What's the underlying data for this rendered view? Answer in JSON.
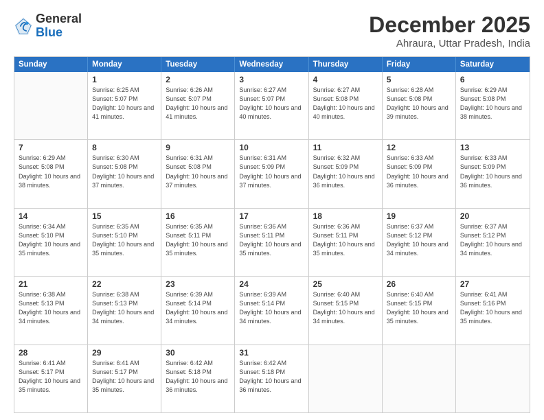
{
  "header": {
    "logo": {
      "general": "General",
      "blue": "Blue"
    },
    "title": "December 2025",
    "subtitle": "Ahraura, Uttar Pradesh, India"
  },
  "calendar": {
    "days_of_week": [
      "Sunday",
      "Monday",
      "Tuesday",
      "Wednesday",
      "Thursday",
      "Friday",
      "Saturday"
    ],
    "weeks": [
      [
        {
          "day": "",
          "sunrise": "",
          "sunset": "",
          "daylight": ""
        },
        {
          "day": "1",
          "sunrise": "Sunrise: 6:25 AM",
          "sunset": "Sunset: 5:07 PM",
          "daylight": "Daylight: 10 hours and 41 minutes."
        },
        {
          "day": "2",
          "sunrise": "Sunrise: 6:26 AM",
          "sunset": "Sunset: 5:07 PM",
          "daylight": "Daylight: 10 hours and 41 minutes."
        },
        {
          "day": "3",
          "sunrise": "Sunrise: 6:27 AM",
          "sunset": "Sunset: 5:07 PM",
          "daylight": "Daylight: 10 hours and 40 minutes."
        },
        {
          "day": "4",
          "sunrise": "Sunrise: 6:27 AM",
          "sunset": "Sunset: 5:08 PM",
          "daylight": "Daylight: 10 hours and 40 minutes."
        },
        {
          "day": "5",
          "sunrise": "Sunrise: 6:28 AM",
          "sunset": "Sunset: 5:08 PM",
          "daylight": "Daylight: 10 hours and 39 minutes."
        },
        {
          "day": "6",
          "sunrise": "Sunrise: 6:29 AM",
          "sunset": "Sunset: 5:08 PM",
          "daylight": "Daylight: 10 hours and 38 minutes."
        }
      ],
      [
        {
          "day": "7",
          "sunrise": "Sunrise: 6:29 AM",
          "sunset": "Sunset: 5:08 PM",
          "daylight": "Daylight: 10 hours and 38 minutes."
        },
        {
          "day": "8",
          "sunrise": "Sunrise: 6:30 AM",
          "sunset": "Sunset: 5:08 PM",
          "daylight": "Daylight: 10 hours and 37 minutes."
        },
        {
          "day": "9",
          "sunrise": "Sunrise: 6:31 AM",
          "sunset": "Sunset: 5:08 PM",
          "daylight": "Daylight: 10 hours and 37 minutes."
        },
        {
          "day": "10",
          "sunrise": "Sunrise: 6:31 AM",
          "sunset": "Sunset: 5:09 PM",
          "daylight": "Daylight: 10 hours and 37 minutes."
        },
        {
          "day": "11",
          "sunrise": "Sunrise: 6:32 AM",
          "sunset": "Sunset: 5:09 PM",
          "daylight": "Daylight: 10 hours and 36 minutes."
        },
        {
          "day": "12",
          "sunrise": "Sunrise: 6:33 AM",
          "sunset": "Sunset: 5:09 PM",
          "daylight": "Daylight: 10 hours and 36 minutes."
        },
        {
          "day": "13",
          "sunrise": "Sunrise: 6:33 AM",
          "sunset": "Sunset: 5:09 PM",
          "daylight": "Daylight: 10 hours and 36 minutes."
        }
      ],
      [
        {
          "day": "14",
          "sunrise": "Sunrise: 6:34 AM",
          "sunset": "Sunset: 5:10 PM",
          "daylight": "Daylight: 10 hours and 35 minutes."
        },
        {
          "day": "15",
          "sunrise": "Sunrise: 6:35 AM",
          "sunset": "Sunset: 5:10 PM",
          "daylight": "Daylight: 10 hours and 35 minutes."
        },
        {
          "day": "16",
          "sunrise": "Sunrise: 6:35 AM",
          "sunset": "Sunset: 5:11 PM",
          "daylight": "Daylight: 10 hours and 35 minutes."
        },
        {
          "day": "17",
          "sunrise": "Sunrise: 6:36 AM",
          "sunset": "Sunset: 5:11 PM",
          "daylight": "Daylight: 10 hours and 35 minutes."
        },
        {
          "day": "18",
          "sunrise": "Sunrise: 6:36 AM",
          "sunset": "Sunset: 5:11 PM",
          "daylight": "Daylight: 10 hours and 35 minutes."
        },
        {
          "day": "19",
          "sunrise": "Sunrise: 6:37 AM",
          "sunset": "Sunset: 5:12 PM",
          "daylight": "Daylight: 10 hours and 34 minutes."
        },
        {
          "day": "20",
          "sunrise": "Sunrise: 6:37 AM",
          "sunset": "Sunset: 5:12 PM",
          "daylight": "Daylight: 10 hours and 34 minutes."
        }
      ],
      [
        {
          "day": "21",
          "sunrise": "Sunrise: 6:38 AM",
          "sunset": "Sunset: 5:13 PM",
          "daylight": "Daylight: 10 hours and 34 minutes."
        },
        {
          "day": "22",
          "sunrise": "Sunrise: 6:38 AM",
          "sunset": "Sunset: 5:13 PM",
          "daylight": "Daylight: 10 hours and 34 minutes."
        },
        {
          "day": "23",
          "sunrise": "Sunrise: 6:39 AM",
          "sunset": "Sunset: 5:14 PM",
          "daylight": "Daylight: 10 hours and 34 minutes."
        },
        {
          "day": "24",
          "sunrise": "Sunrise: 6:39 AM",
          "sunset": "Sunset: 5:14 PM",
          "daylight": "Daylight: 10 hours and 34 minutes."
        },
        {
          "day": "25",
          "sunrise": "Sunrise: 6:40 AM",
          "sunset": "Sunset: 5:15 PM",
          "daylight": "Daylight: 10 hours and 34 minutes."
        },
        {
          "day": "26",
          "sunrise": "Sunrise: 6:40 AM",
          "sunset": "Sunset: 5:15 PM",
          "daylight": "Daylight: 10 hours and 35 minutes."
        },
        {
          "day": "27",
          "sunrise": "Sunrise: 6:41 AM",
          "sunset": "Sunset: 5:16 PM",
          "daylight": "Daylight: 10 hours and 35 minutes."
        }
      ],
      [
        {
          "day": "28",
          "sunrise": "Sunrise: 6:41 AM",
          "sunset": "Sunset: 5:17 PM",
          "daylight": "Daylight: 10 hours and 35 minutes."
        },
        {
          "day": "29",
          "sunrise": "Sunrise: 6:41 AM",
          "sunset": "Sunset: 5:17 PM",
          "daylight": "Daylight: 10 hours and 35 minutes."
        },
        {
          "day": "30",
          "sunrise": "Sunrise: 6:42 AM",
          "sunset": "Sunset: 5:18 PM",
          "daylight": "Daylight: 10 hours and 36 minutes."
        },
        {
          "day": "31",
          "sunrise": "Sunrise: 6:42 AM",
          "sunset": "Sunset: 5:18 PM",
          "daylight": "Daylight: 10 hours and 36 minutes."
        },
        {
          "day": "",
          "sunrise": "",
          "sunset": "",
          "daylight": ""
        },
        {
          "day": "",
          "sunrise": "",
          "sunset": "",
          "daylight": ""
        },
        {
          "day": "",
          "sunrise": "",
          "sunset": "",
          "daylight": ""
        }
      ]
    ]
  }
}
